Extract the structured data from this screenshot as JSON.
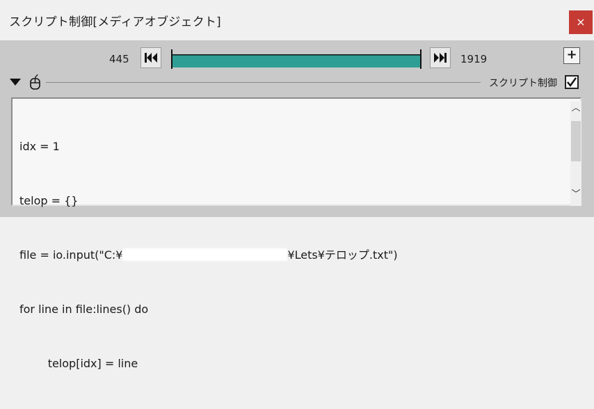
{
  "window": {
    "title": "スクリプト制御[メディアオブジェクト]",
    "close_label": "×"
  },
  "timeline": {
    "start_frame": "445",
    "end_frame": "1919",
    "progress": 1.0,
    "rewind_icon": "rewind-icon",
    "forward_icon": "fast-forward-icon",
    "add_label": "+"
  },
  "section": {
    "collapse_icon": "triangle-down-icon",
    "mouse_icon": "mouse-icon",
    "checkbox_label": "スクリプト制御",
    "checkbox_checked": true
  },
  "editor": {
    "lines": [
      "idx = 1",
      "telop = {}",
      "file = io.input(\"C:¥",
      "for line in file:lines() do",
      "        telop[idx] = line"
    ],
    "line3_tail": "¥Lets¥テロップ.txt\")"
  },
  "colors": {
    "slider_fill": "#2f9f96",
    "close_bg": "#c53a33"
  }
}
